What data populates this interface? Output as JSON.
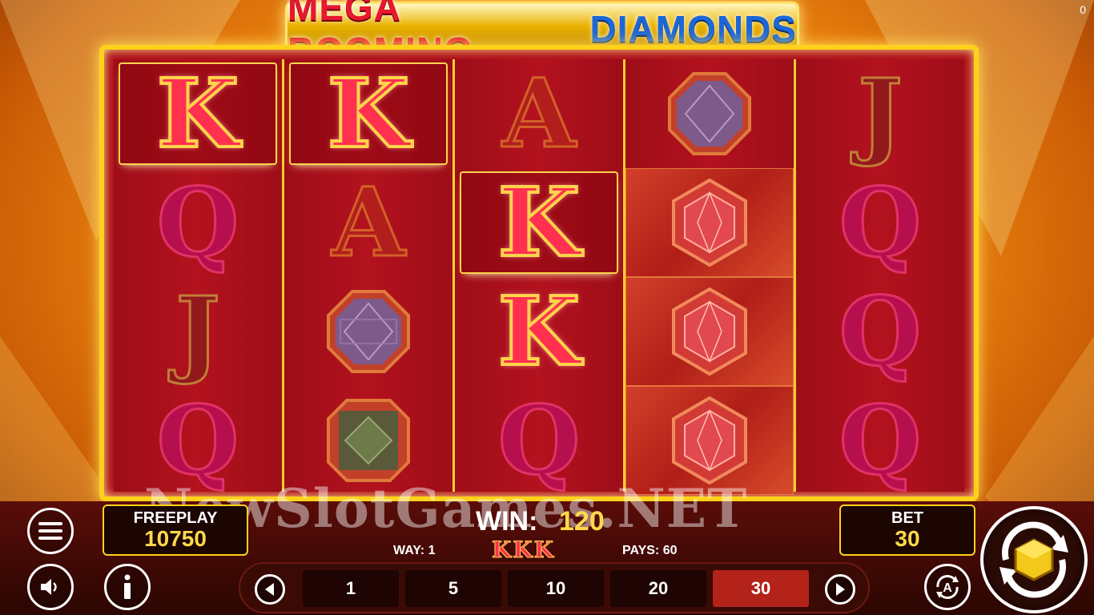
{
  "window": {
    "counter": "0"
  },
  "title": {
    "part1": "MEGA BOOMING",
    "part2": "DIAMONDS"
  },
  "reels": [
    [
      "K",
      "Q",
      "J",
      "Q"
    ],
    [
      "K",
      "A",
      "gem-purple",
      "gem-green"
    ],
    [
      "A",
      "K",
      "K",
      "Q"
    ],
    [
      "gem-purple",
      "gem-red",
      "gem-red",
      "gem-red"
    ],
    [
      "J",
      "Q",
      "Q",
      "Q"
    ]
  ],
  "watermark": "NewSlotGames.NET",
  "freeplay": {
    "label": "FREEPLAY",
    "value": "10750"
  },
  "win": {
    "label": "WIN:",
    "amount": "120",
    "way": "WAY: 1",
    "symbols": "KKK",
    "pays": "PAYS: 60"
  },
  "bet": {
    "label": "BET",
    "value": "30"
  },
  "bet_options": [
    "1",
    "5",
    "10",
    "20",
    "30"
  ],
  "bet_selected": "30",
  "icons": {
    "menu": "menu-icon",
    "sound": "speaker-icon",
    "info": "info-icon",
    "prev": "left-arrow-icon",
    "next": "right-arrow-icon",
    "autoplay": "autoplay-icon",
    "spin": "spin-icon"
  },
  "colors": {
    "accent_gold": "#ffd21a",
    "reel_red": "#b0101c",
    "selected_bet": "#b3231a",
    "win_yellow": "#ffd84a"
  }
}
